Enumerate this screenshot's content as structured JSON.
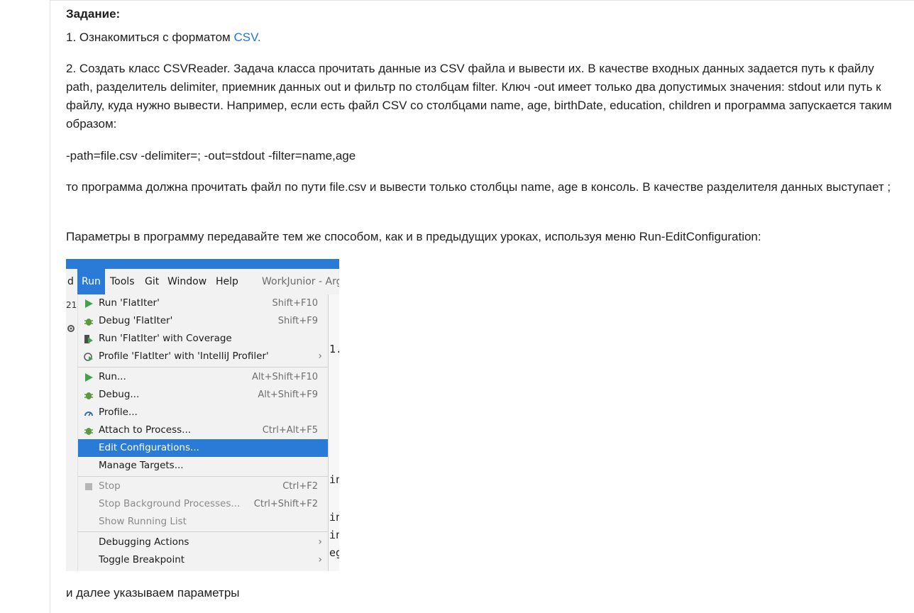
{
  "task": {
    "title": "Задание:",
    "item1_prefix": "1. Ознакомиться с форматом ",
    "item1_link": "CSV.",
    "paragraph2": "2. Создать класс CSVReader. Задача класса прочитать данные из CSV файла и вывести их. В качестве входных данных задается путь к файлу path, разделитель delimiter, приемник данных out и фильтр по столбцам filter. Ключ -out имеет только два допустимых значения: stdout или путь к файлу, куда нужно вывести. Например, если есть файл CSV со столбцами name, age, birthDate, education, children и программа запускается таким образом:",
    "command_example": " -path=file.csv -delimiter=;  -out=stdout -filter=name,age",
    "paragraph3": "то программа должна прочитать файл по пути file.csv и вывести только столбцы name, age в консоль. В качестве разделителя данных выступает ;",
    "paragraph4": "Параметры в программу передавайте тем же способом, как и в предыдущих уроках, используя меню  Run-EditConfiguration:",
    "paragraph5": "и далее указываем параметры"
  },
  "ide": {
    "menubar": {
      "clipped_item": "d",
      "run": "Run",
      "tools": "Tools",
      "git": "Git",
      "window": "Window",
      "help": "Help",
      "project": "WorkJunior - Arg"
    },
    "left_strip": {
      "num": "21"
    },
    "editor_fragments": [
      "1.",
      "in",
      "in",
      "in",
      "eg"
    ],
    "menu": {
      "run_flatiter": {
        "label": "Run 'FlatIter'",
        "shortcut": "Shift+F10"
      },
      "debug_flatiter": {
        "label": "Debug 'FlatIter'",
        "shortcut": "Shift+F9"
      },
      "run_coverage": {
        "label": "Run 'FlatIter' with Coverage"
      },
      "profile_flatiter": {
        "label": "Profile 'FlatIter' with 'IntelliJ Profiler'",
        "arrow": "›"
      },
      "run": {
        "label": "Run...",
        "shortcut": "Alt+Shift+F10"
      },
      "debug": {
        "label": "Debug...",
        "shortcut": "Alt+Shift+F9"
      },
      "profile": {
        "label": "Profile..."
      },
      "attach": {
        "label": "Attach to Process...",
        "shortcut": "Ctrl+Alt+F5"
      },
      "edit_configurations": {
        "label": "Edit Configurations..."
      },
      "manage_targets": {
        "label": "Manage Targets..."
      },
      "stop": {
        "label": "Stop",
        "shortcut": "Ctrl+F2"
      },
      "stop_background": {
        "label": "Stop Background Processes...",
        "shortcut": "Ctrl+Shift+F2"
      },
      "show_running": {
        "label": "Show Running List"
      },
      "debugging_actions": {
        "label": "Debugging Actions",
        "arrow": "›"
      },
      "toggle_breakpoint": {
        "label": "Toggle Breakpoint",
        "arrow": "›"
      }
    },
    "colors": {
      "accent": "#2a7bd8",
      "run_green": "#3fa34d",
      "menu_bg": "#f2f2f2"
    }
  }
}
